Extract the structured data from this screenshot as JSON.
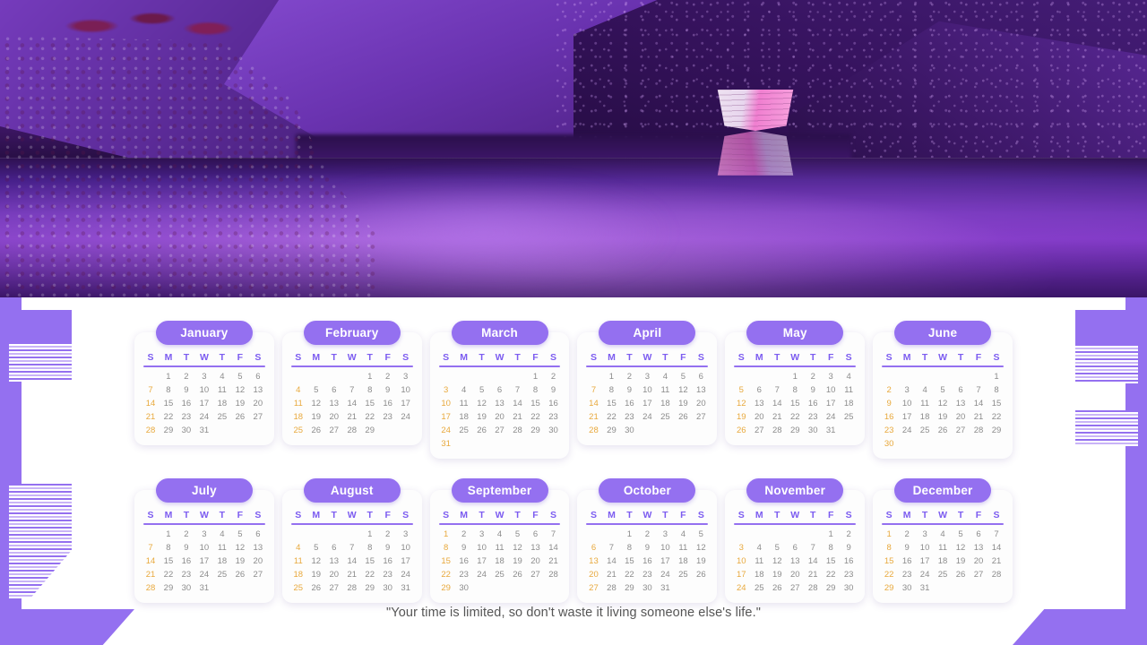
{
  "hero": {
    "alt": "purple-tinted mountain lake with rocks and a rowboat reflection",
    "scene_elements": [
      "mountain-ridges",
      "lake-water",
      "rowboat",
      "boat-reflection",
      "pink-rocks",
      "palm-foliage"
    ]
  },
  "quote": {
    "text": "\"Your time is limited, so don't waste it living someone else's life.\""
  },
  "colors": {
    "accent_purple": "#9470f0",
    "weekday_header": "#7c5cf0",
    "sunday": "#e8a93d",
    "weekday": "#8c8c8c",
    "panel": "#ffffff"
  },
  "calendar": {
    "weekdays": [
      "S",
      "M",
      "T",
      "W",
      "T",
      "F",
      "S"
    ],
    "months": [
      {
        "name": "January",
        "start": 1,
        "days": 31
      },
      {
        "name": "February",
        "start": 4,
        "days": 29
      },
      {
        "name": "March",
        "start": 5,
        "days": 31
      },
      {
        "name": "April",
        "start": 1,
        "days": 30
      },
      {
        "name": "May",
        "start": 3,
        "days": 31
      },
      {
        "name": "June",
        "start": 6,
        "days": 30
      },
      {
        "name": "July",
        "start": 1,
        "days": 31
      },
      {
        "name": "August",
        "start": 4,
        "days": 31
      },
      {
        "name": "September",
        "start": 0,
        "days": 30
      },
      {
        "name": "October",
        "start": 2,
        "days": 31
      },
      {
        "name": "November",
        "start": 5,
        "days": 30
      },
      {
        "name": "December",
        "start": 0,
        "days": 31
      }
    ]
  }
}
